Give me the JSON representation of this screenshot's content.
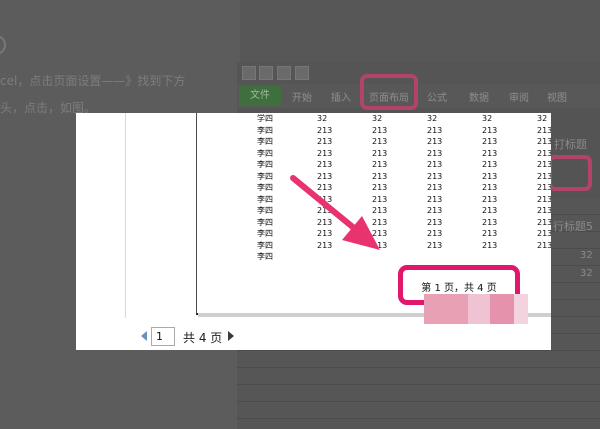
{
  "article": {
    "line1": "cel，点击页面设置——》找到下方",
    "line2": "头，点击，如图。"
  },
  "excel_tabs": {
    "file": "文件",
    "start": "开始",
    "insert": "插入",
    "page_layout": "页面布局",
    "formula": "公式",
    "data": "数据",
    "review": "审阅",
    "view": "视图"
  },
  "excel_side": {
    "label1": "打标题",
    "label2": "行标题5",
    "cell1": "32",
    "cell2": "32"
  },
  "sheet": {
    "header_row": [
      "学四",
      "32",
      "32",
      "32",
      "32",
      "32"
    ],
    "data_rows": [
      [
        "李四",
        "213",
        "213",
        "213",
        "213",
        "213"
      ],
      [
        "李四",
        "213",
        "213",
        "213",
        "213",
        "213"
      ],
      [
        "李四",
        "213",
        "213",
        "213",
        "213",
        "213"
      ],
      [
        "李四",
        "213",
        "213",
        "213",
        "213",
        "213"
      ],
      [
        "李四",
        "213",
        "213",
        "213",
        "213",
        "213"
      ],
      [
        "李四",
        "213",
        "213",
        "213",
        "213",
        "213"
      ],
      [
        "李四",
        "213",
        "213",
        "213",
        "213",
        "213"
      ],
      [
        "李四",
        "213",
        "213",
        "213",
        "213",
        "213"
      ],
      [
        "李四",
        "213",
        "213",
        "213",
        "213",
        "213"
      ],
      [
        "李四",
        "213",
        "213",
        "213",
        "213",
        "213"
      ],
      [
        "李四",
        "213",
        "213",
        "213",
        "213",
        "213"
      ],
      [
        "李四",
        "",
        "",
        "",
        "",
        ""
      ]
    ],
    "footer_text": "第 1 页，共 4 页"
  },
  "pager": {
    "current_page": "1",
    "total_text": "共 4 页"
  },
  "colors": {
    "highlight": "#e0176a",
    "arrow": "#e8336f"
  }
}
